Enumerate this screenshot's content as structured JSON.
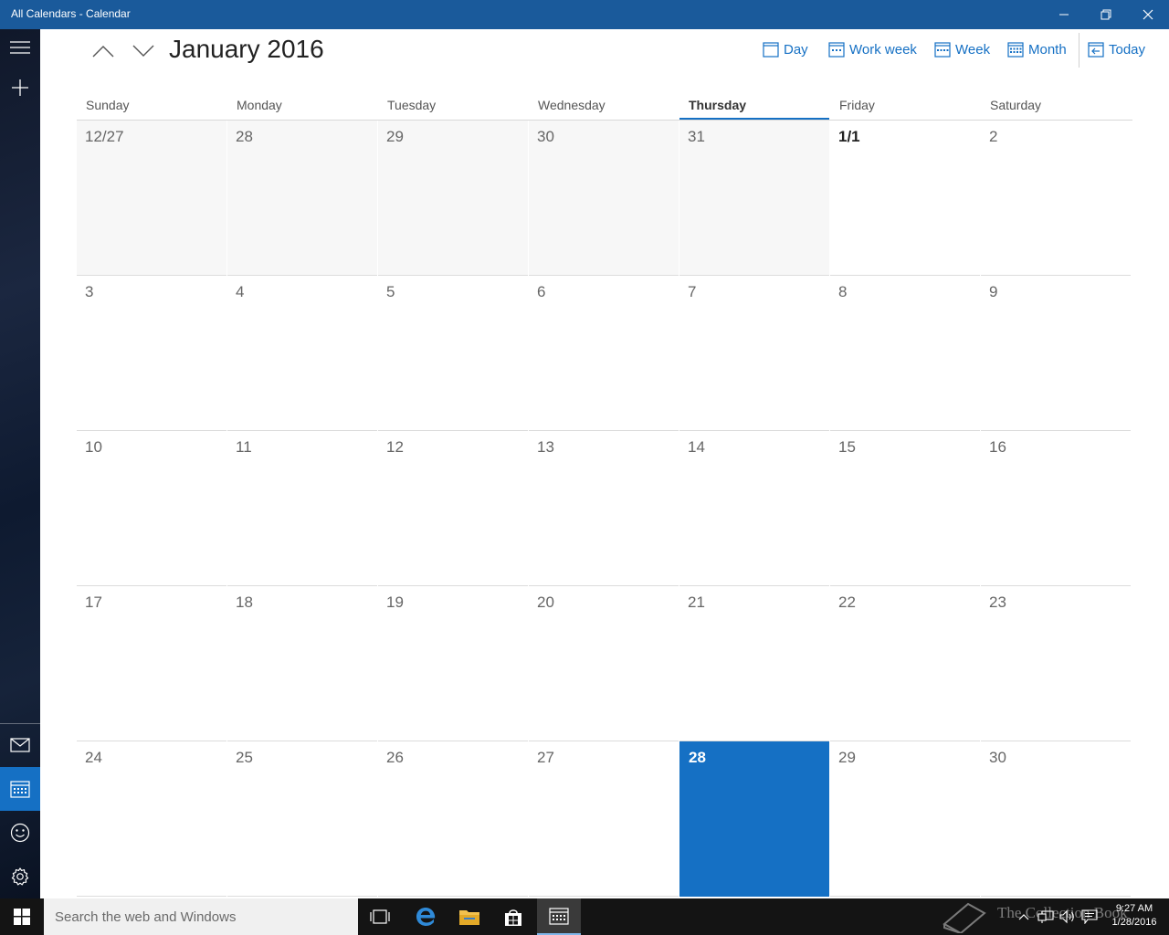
{
  "window": {
    "title": "All Calendars - Calendar"
  },
  "header": {
    "month_title": "January 2016",
    "views": [
      {
        "label": "Day",
        "icon": "day-view-icon"
      },
      {
        "label": "Work week",
        "icon": "work-week-view-icon"
      },
      {
        "label": "Week",
        "icon": "week-view-icon"
      },
      {
        "label": "Month",
        "icon": "month-view-icon"
      },
      {
        "label": "Today",
        "icon": "today-icon"
      }
    ]
  },
  "calendar": {
    "weekdays": [
      "Sunday",
      "Monday",
      "Tuesday",
      "Wednesday",
      "Thursday",
      "Friday",
      "Saturday"
    ],
    "today_weekday": "Thursday",
    "weeks": [
      [
        "12/27",
        "28",
        "29",
        "30",
        "31",
        "1/1",
        "2"
      ],
      [
        "3",
        "4",
        "5",
        "6",
        "7",
        "8",
        "9"
      ],
      [
        "10",
        "11",
        "12",
        "13",
        "14",
        "15",
        "16"
      ],
      [
        "17",
        "18",
        "19",
        "20",
        "21",
        "22",
        "23"
      ],
      [
        "24",
        "25",
        "26",
        "27",
        "28",
        "29",
        "30"
      ]
    ],
    "today_label": "28"
  },
  "taskbar": {
    "search_placeholder": "Search the web and Windows",
    "watermark": "The Collection Book",
    "time": "9:27 AM",
    "date": "1/28/2016"
  },
  "colors": {
    "accent": "#1570c4",
    "titlebar": "#1a5a9b",
    "taskbar": "#141414"
  }
}
